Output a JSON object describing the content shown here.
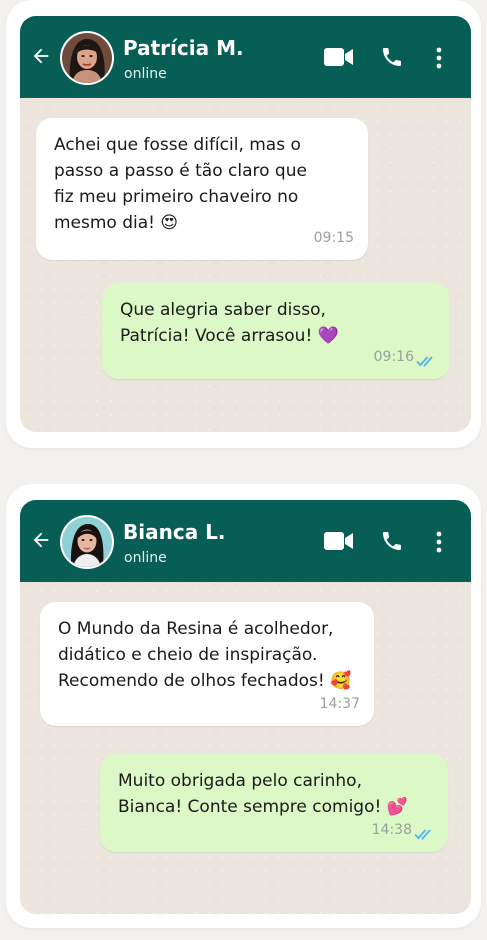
{
  "colors": {
    "header": "#075e54",
    "chat_background": "#ece5dd",
    "incoming_bubble": "#ffffff",
    "outgoing_bubble": "#dcf8c6",
    "read_ticks": "#4fb6ec"
  },
  "icons": {
    "back": "arrow-left-icon",
    "video": "video-call-icon",
    "call": "phone-icon",
    "menu": "more-vertical-icon",
    "read": "double-check-icon"
  },
  "chats": [
    {
      "contact": {
        "name": "Patrícia M.",
        "status": "online"
      },
      "messages": [
        {
          "direction": "incoming",
          "text": "Achei que fosse difícil, mas o\npasso a passo é tão claro que\nfiz meu primeiro chaveiro no\nmesmo dia! 😍",
          "time": "09:15"
        },
        {
          "direction": "outgoing",
          "text": "Que alegria saber disso,\nPatrícia! Você arrasou! 💜",
          "time": "09:16"
        }
      ]
    },
    {
      "contact": {
        "name": "Bianca L.",
        "status": "online"
      },
      "messages": [
        {
          "direction": "incoming",
          "text": "O Mundo da Resina é acolhedor,\ndidático e cheio de inspiração.\nRecomendo de olhos fechados! 🥰",
          "time": "14:37"
        },
        {
          "direction": "outgoing",
          "text": "Muito obrigada pelo carinho,\nBianca! Conte sempre comigo! 💕",
          "time": "14:38"
        }
      ]
    }
  ]
}
